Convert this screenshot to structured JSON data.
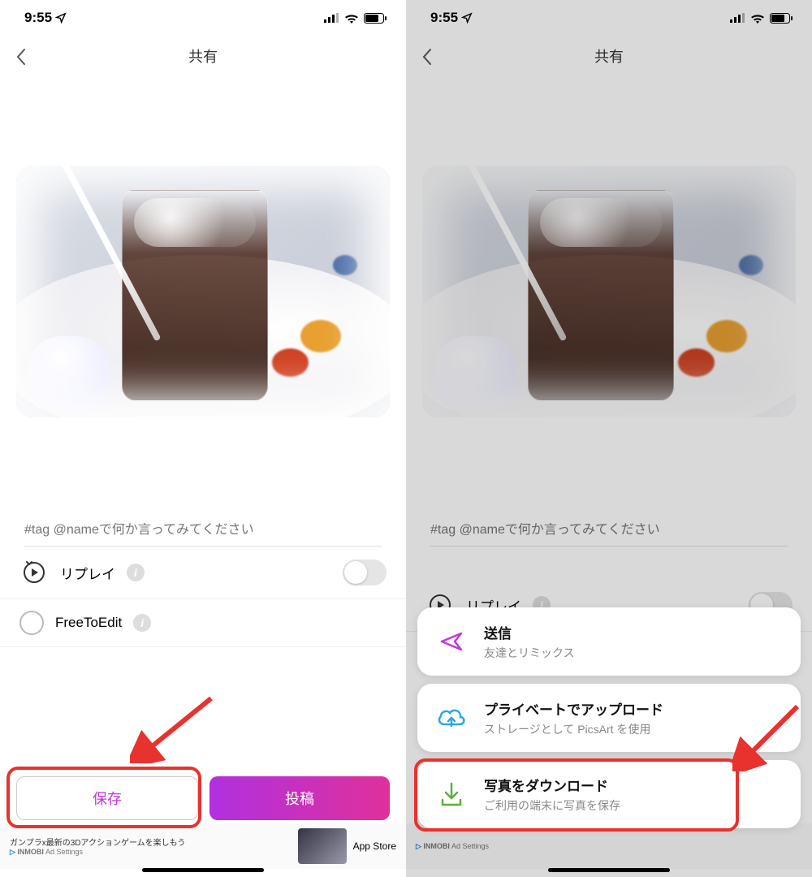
{
  "status": {
    "time": "9:55"
  },
  "nav": {
    "title": "共有"
  },
  "caption": {
    "placeholder": "#tag @nameで何か言ってみてください"
  },
  "options": {
    "replay": "リプレイ",
    "free_to_edit": "FreeToEdit"
  },
  "buttons": {
    "save": "保存",
    "post": "投稿"
  },
  "ad": {
    "line1": "ガンプラx最新の3Dアクションゲームを楽しもう",
    "brand": "INMOBI",
    "settings": "Ad Settings",
    "store": "App Store"
  },
  "sheet": {
    "send": {
      "title": "送信",
      "sub": "友達とリミックス"
    },
    "private": {
      "title": "プライベートでアップロード",
      "sub": "ストレージとして PicsArt を使用"
    },
    "download": {
      "title": "写真をダウンロード",
      "sub": "ご利用の端末に写真を保存"
    }
  }
}
